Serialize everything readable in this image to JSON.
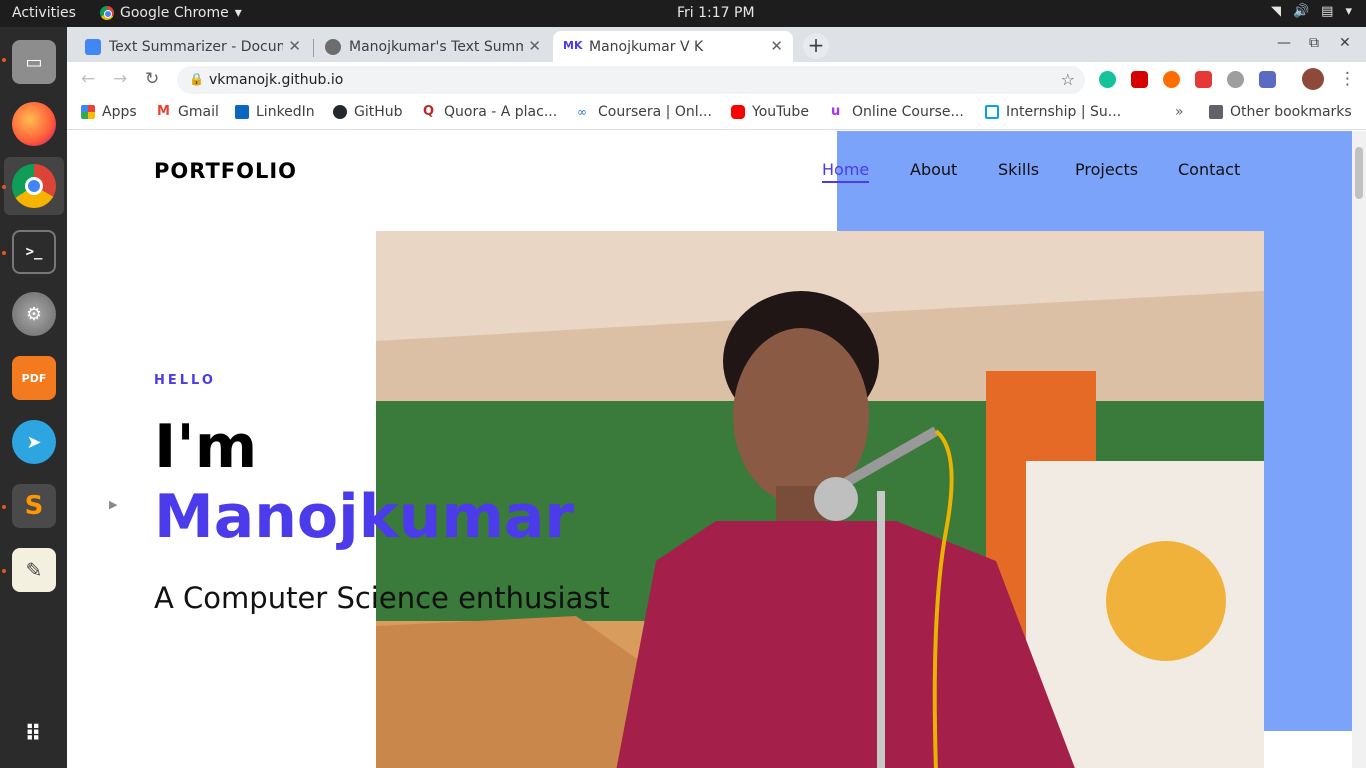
{
  "os": {
    "activities": "Activities",
    "app_name": "Google Chrome",
    "clock": "Fri  1:17 PM"
  },
  "browser": {
    "tabs": [
      {
        "title": "Text Summarizer - Docum",
        "icon": "docs-icon"
      },
      {
        "title": "Manojkumar's Text Summ",
        "icon": "globe-icon"
      },
      {
        "title": "Manojkumar V K",
        "icon": "mk-icon",
        "favicon_text": "MK",
        "active": true
      }
    ],
    "url": "vkmanojk.github.io",
    "bookmarks": [
      {
        "label": "Apps",
        "icon": "apps-grid-icon"
      },
      {
        "label": "Gmail",
        "icon": "gmail-icon"
      },
      {
        "label": "LinkedIn",
        "icon": "linkedin-icon"
      },
      {
        "label": "GitHub",
        "icon": "github-icon"
      },
      {
        "label": "Quora - A plac...",
        "icon": "quora-icon"
      },
      {
        "label": "Coursera | Onl...",
        "icon": "coursera-icon"
      },
      {
        "label": "YouTube",
        "icon": "youtube-icon"
      },
      {
        "label": "Online Course...",
        "icon": "udemy-icon"
      },
      {
        "label": "Internship | Su...",
        "icon": "internshala-icon"
      },
      {
        "label": "Other bookmarks",
        "icon": "folder-icon"
      }
    ],
    "bookmarks_overflow": "»"
  },
  "page": {
    "logo": "PORTFOLIO",
    "nav": [
      "Home",
      "About",
      "Skills",
      "Projects",
      "Contact"
    ],
    "active_nav": "Home",
    "hello": "HELLO",
    "intro": "I'm",
    "name": "Manojkumar",
    "tagline": "A Computer Science enthusiast",
    "accent_color": "#4b3bea",
    "panel_color": "#7ba3fa"
  }
}
